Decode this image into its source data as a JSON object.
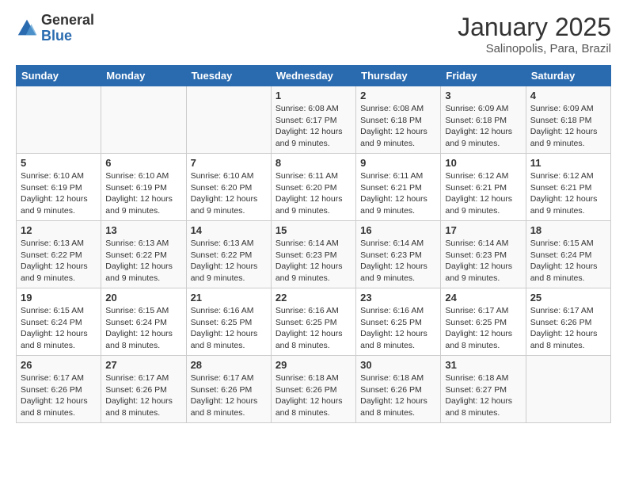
{
  "logo": {
    "general": "General",
    "blue": "Blue"
  },
  "title": "January 2025",
  "subtitle": "Salinopolis, Para, Brazil",
  "weekdays": [
    "Sunday",
    "Monday",
    "Tuesday",
    "Wednesday",
    "Thursday",
    "Friday",
    "Saturday"
  ],
  "weeks": [
    [
      {
        "day": "",
        "info": ""
      },
      {
        "day": "",
        "info": ""
      },
      {
        "day": "",
        "info": ""
      },
      {
        "day": "1",
        "info": "Sunrise: 6:08 AM\nSunset: 6:17 PM\nDaylight: 12 hours and 9 minutes."
      },
      {
        "day": "2",
        "info": "Sunrise: 6:08 AM\nSunset: 6:18 PM\nDaylight: 12 hours and 9 minutes."
      },
      {
        "day": "3",
        "info": "Sunrise: 6:09 AM\nSunset: 6:18 PM\nDaylight: 12 hours and 9 minutes."
      },
      {
        "day": "4",
        "info": "Sunrise: 6:09 AM\nSunset: 6:18 PM\nDaylight: 12 hours and 9 minutes."
      }
    ],
    [
      {
        "day": "5",
        "info": "Sunrise: 6:10 AM\nSunset: 6:19 PM\nDaylight: 12 hours and 9 minutes."
      },
      {
        "day": "6",
        "info": "Sunrise: 6:10 AM\nSunset: 6:19 PM\nDaylight: 12 hours and 9 minutes."
      },
      {
        "day": "7",
        "info": "Sunrise: 6:10 AM\nSunset: 6:20 PM\nDaylight: 12 hours and 9 minutes."
      },
      {
        "day": "8",
        "info": "Sunrise: 6:11 AM\nSunset: 6:20 PM\nDaylight: 12 hours and 9 minutes."
      },
      {
        "day": "9",
        "info": "Sunrise: 6:11 AM\nSunset: 6:21 PM\nDaylight: 12 hours and 9 minutes."
      },
      {
        "day": "10",
        "info": "Sunrise: 6:12 AM\nSunset: 6:21 PM\nDaylight: 12 hours and 9 minutes."
      },
      {
        "day": "11",
        "info": "Sunrise: 6:12 AM\nSunset: 6:21 PM\nDaylight: 12 hours and 9 minutes."
      }
    ],
    [
      {
        "day": "12",
        "info": "Sunrise: 6:13 AM\nSunset: 6:22 PM\nDaylight: 12 hours and 9 minutes."
      },
      {
        "day": "13",
        "info": "Sunrise: 6:13 AM\nSunset: 6:22 PM\nDaylight: 12 hours and 9 minutes."
      },
      {
        "day": "14",
        "info": "Sunrise: 6:13 AM\nSunset: 6:22 PM\nDaylight: 12 hours and 9 minutes."
      },
      {
        "day": "15",
        "info": "Sunrise: 6:14 AM\nSunset: 6:23 PM\nDaylight: 12 hours and 9 minutes."
      },
      {
        "day": "16",
        "info": "Sunrise: 6:14 AM\nSunset: 6:23 PM\nDaylight: 12 hours and 9 minutes."
      },
      {
        "day": "17",
        "info": "Sunrise: 6:14 AM\nSunset: 6:23 PM\nDaylight: 12 hours and 9 minutes."
      },
      {
        "day": "18",
        "info": "Sunrise: 6:15 AM\nSunset: 6:24 PM\nDaylight: 12 hours and 8 minutes."
      }
    ],
    [
      {
        "day": "19",
        "info": "Sunrise: 6:15 AM\nSunset: 6:24 PM\nDaylight: 12 hours and 8 minutes."
      },
      {
        "day": "20",
        "info": "Sunrise: 6:15 AM\nSunset: 6:24 PM\nDaylight: 12 hours and 8 minutes."
      },
      {
        "day": "21",
        "info": "Sunrise: 6:16 AM\nSunset: 6:25 PM\nDaylight: 12 hours and 8 minutes."
      },
      {
        "day": "22",
        "info": "Sunrise: 6:16 AM\nSunset: 6:25 PM\nDaylight: 12 hours and 8 minutes."
      },
      {
        "day": "23",
        "info": "Sunrise: 6:16 AM\nSunset: 6:25 PM\nDaylight: 12 hours and 8 minutes."
      },
      {
        "day": "24",
        "info": "Sunrise: 6:17 AM\nSunset: 6:25 PM\nDaylight: 12 hours and 8 minutes."
      },
      {
        "day": "25",
        "info": "Sunrise: 6:17 AM\nSunset: 6:26 PM\nDaylight: 12 hours and 8 minutes."
      }
    ],
    [
      {
        "day": "26",
        "info": "Sunrise: 6:17 AM\nSunset: 6:26 PM\nDaylight: 12 hours and 8 minutes."
      },
      {
        "day": "27",
        "info": "Sunrise: 6:17 AM\nSunset: 6:26 PM\nDaylight: 12 hours and 8 minutes."
      },
      {
        "day": "28",
        "info": "Sunrise: 6:17 AM\nSunset: 6:26 PM\nDaylight: 12 hours and 8 minutes."
      },
      {
        "day": "29",
        "info": "Sunrise: 6:18 AM\nSunset: 6:26 PM\nDaylight: 12 hours and 8 minutes."
      },
      {
        "day": "30",
        "info": "Sunrise: 6:18 AM\nSunset: 6:26 PM\nDaylight: 12 hours and 8 minutes."
      },
      {
        "day": "31",
        "info": "Sunrise: 6:18 AM\nSunset: 6:27 PM\nDaylight: 12 hours and 8 minutes."
      },
      {
        "day": "",
        "info": ""
      }
    ]
  ]
}
